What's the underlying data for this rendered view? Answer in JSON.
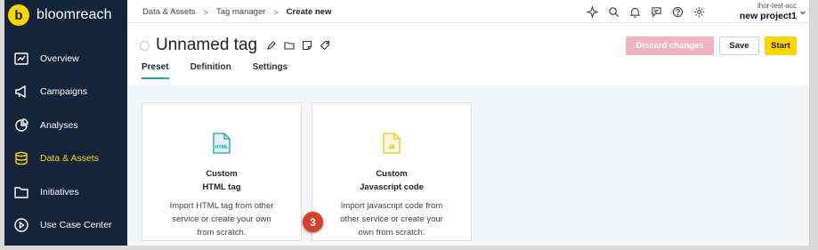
{
  "brand": {
    "logo_letter": "b",
    "name": "bloomreach"
  },
  "sidebar": {
    "items": [
      {
        "label": "Overview",
        "icon": "chart-board-icon",
        "active": false
      },
      {
        "label": "Campaigns",
        "icon": "megaphone-icon",
        "active": false
      },
      {
        "label": "Analyses",
        "icon": "pie-chart-icon",
        "active": false
      },
      {
        "label": "Data & Assets",
        "icon": "database-icon",
        "active": true
      },
      {
        "label": "Initiatives",
        "icon": "folder-icon",
        "active": false
      },
      {
        "label": "Use Case Center",
        "icon": "play-circle-icon",
        "active": false
      }
    ]
  },
  "breadcrumb": {
    "items": [
      "Data & Assets",
      "Tag manager"
    ],
    "current": "Create new",
    "separator": ">"
  },
  "topbar_icons": [
    "sparkle-icon",
    "search-icon",
    "bell-icon",
    "chat-icon",
    "help-icon",
    "gear-icon"
  ],
  "account": {
    "user": "ihor-test-acc",
    "project": "new project1"
  },
  "page": {
    "title": "Unnamed tag",
    "tabs": [
      "Preset",
      "Definition",
      "Settings"
    ],
    "active_tab": "Preset",
    "buttons": {
      "discard": "Discard changes",
      "save": "Save",
      "start": "Start"
    }
  },
  "cards": [
    {
      "icon_text": "HTML",
      "title_line1": "Custom",
      "title_line2": "HTML tag",
      "desc": [
        "Import HTML tag from other",
        "service or create your own",
        "from scratch."
      ]
    },
    {
      "icon_text": "JS",
      "title_line1": "Custom",
      "title_line2": "Javascript code",
      "desc": [
        "Import javascript code from",
        "other service or create your",
        "own from scratch."
      ]
    }
  ],
  "step_badge": "3",
  "colors": {
    "sidebar_bg": "#13243b",
    "accent_yellow": "#ffd500",
    "tab_underline": "#1a9fc0",
    "discard_bg": "#f1b3bf",
    "badge_red": "#d6412a",
    "html_icon": "#1a9fc0",
    "js_icon": "#f0c419"
  }
}
